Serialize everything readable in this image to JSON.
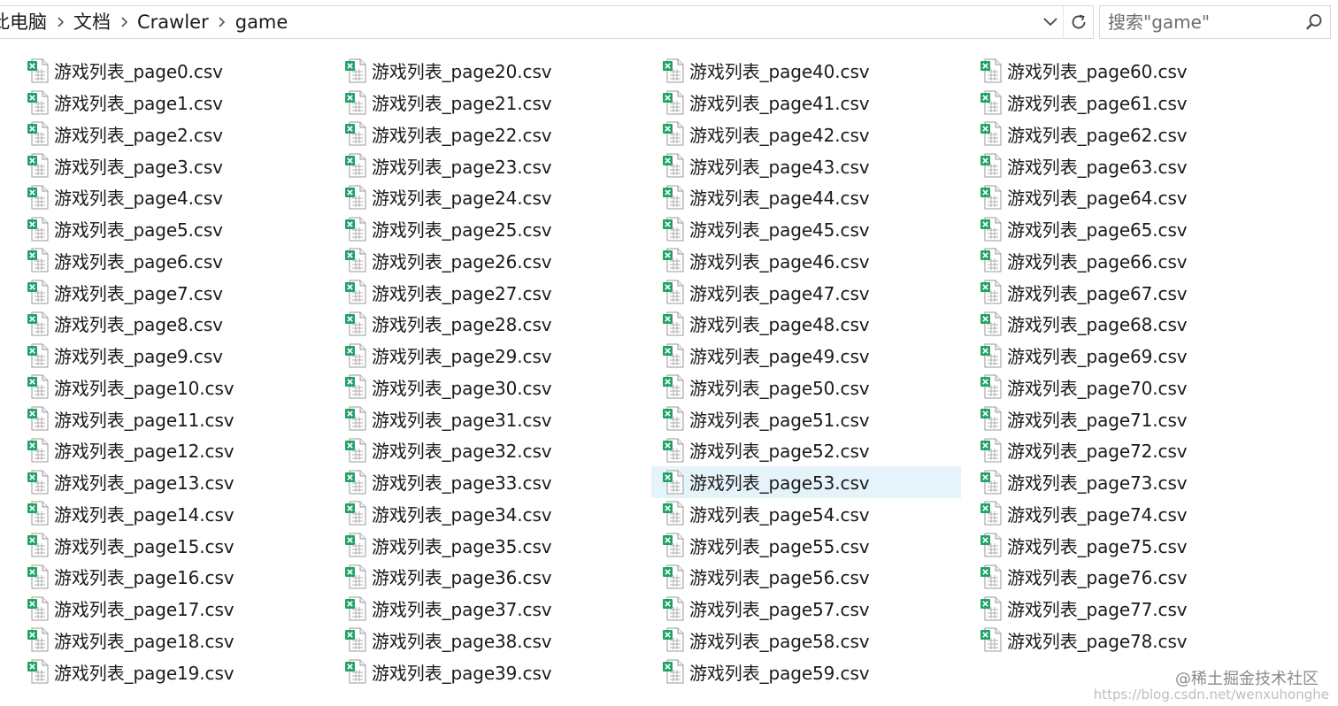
{
  "address_bar": {
    "breadcrumbs": [
      "此电脑",
      "文档",
      "Crawler",
      "game"
    ]
  },
  "search": {
    "placeholder": "搜索\"game\""
  },
  "icons": {
    "separator": "chevron-right-icon",
    "dropdown": "chevron-down-icon",
    "refresh": "refresh-icon",
    "search": "search-icon",
    "file": "excel-csv-file-icon"
  },
  "colors": {
    "selection": "#e5f3fb",
    "excel_green": "#21a366"
  },
  "files": [
    "游戏列表_page0.csv",
    "游戏列表_page1.csv",
    "游戏列表_page2.csv",
    "游戏列表_page3.csv",
    "游戏列表_page4.csv",
    "游戏列表_page5.csv",
    "游戏列表_page6.csv",
    "游戏列表_page7.csv",
    "游戏列表_page8.csv",
    "游戏列表_page9.csv",
    "游戏列表_page10.csv",
    "游戏列表_page11.csv",
    "游戏列表_page12.csv",
    "游戏列表_page13.csv",
    "游戏列表_page14.csv",
    "游戏列表_page15.csv",
    "游戏列表_page16.csv",
    "游戏列表_page17.csv",
    "游戏列表_page18.csv",
    "游戏列表_page19.csv",
    "游戏列表_page20.csv",
    "游戏列表_page21.csv",
    "游戏列表_page22.csv",
    "游戏列表_page23.csv",
    "游戏列表_page24.csv",
    "游戏列表_page25.csv",
    "游戏列表_page26.csv",
    "游戏列表_page27.csv",
    "游戏列表_page28.csv",
    "游戏列表_page29.csv",
    "游戏列表_page30.csv",
    "游戏列表_page31.csv",
    "游戏列表_page32.csv",
    "游戏列表_page33.csv",
    "游戏列表_page34.csv",
    "游戏列表_page35.csv",
    "游戏列表_page36.csv",
    "游戏列表_page37.csv",
    "游戏列表_page38.csv",
    "游戏列表_page39.csv",
    "游戏列表_page40.csv",
    "游戏列表_page41.csv",
    "游戏列表_page42.csv",
    "游戏列表_page43.csv",
    "游戏列表_page44.csv",
    "游戏列表_page45.csv",
    "游戏列表_page46.csv",
    "游戏列表_page47.csv",
    "游戏列表_page48.csv",
    "游戏列表_page49.csv",
    "游戏列表_page50.csv",
    "游戏列表_page51.csv",
    "游戏列表_page52.csv",
    "游戏列表_page53.csv",
    "游戏列表_page54.csv",
    "游戏列表_page55.csv",
    "游戏列表_page56.csv",
    "游戏列表_page57.csv",
    "游戏列表_page58.csv",
    "游戏列表_page59.csv",
    "游戏列表_page60.csv",
    "游戏列表_page61.csv",
    "游戏列表_page62.csv",
    "游戏列表_page63.csv",
    "游戏列表_page64.csv",
    "游戏列表_page65.csv",
    "游戏列表_page66.csv",
    "游戏列表_page67.csv",
    "游戏列表_page68.csv",
    "游戏列表_page69.csv",
    "游戏列表_page70.csv",
    "游戏列表_page71.csv",
    "游戏列表_page72.csv",
    "游戏列表_page73.csv",
    "游戏列表_page74.csv",
    "游戏列表_page75.csv",
    "游戏列表_page76.csv",
    "游戏列表_page77.csv",
    "游戏列表_page78.csv"
  ],
  "hovered_file": "游戏列表_page53.csv",
  "watermark": {
    "site": "@稀土掘金技术社区",
    "url": "https://blog.csdn.net/wenxuhonghe"
  }
}
